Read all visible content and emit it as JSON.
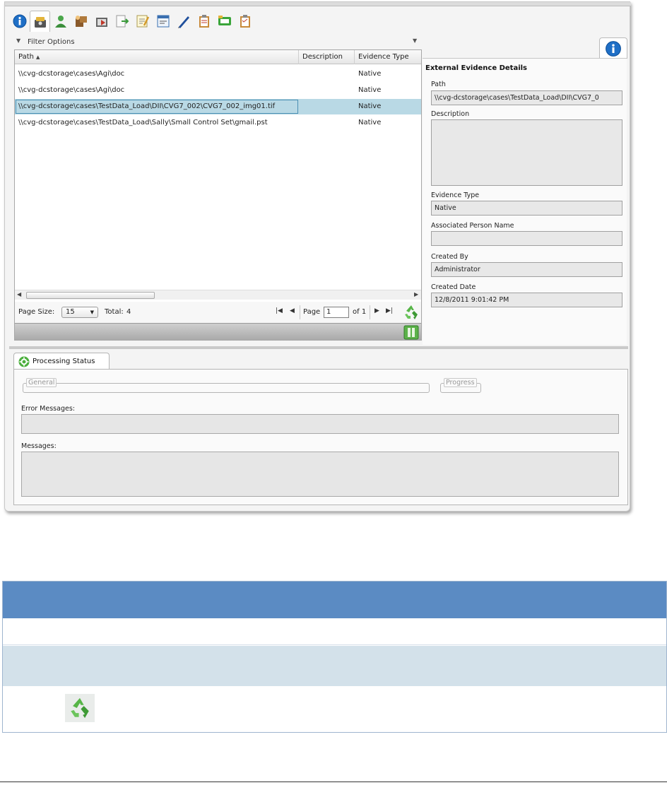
{
  "toolbar": {
    "icons": [
      "info-icon",
      "evidence-drive-icon",
      "person-icon",
      "custodian-boxes-icon",
      "media-icon",
      "export-icon",
      "notes-icon",
      "form-icon",
      "pen-icon",
      "clipboard-icon",
      "transfer-icon",
      "checklist-icon"
    ],
    "active_index": 1
  },
  "filter": {
    "label": "Filter Options"
  },
  "grid": {
    "columns": [
      "Path",
      "Description",
      "Evidence Type"
    ],
    "rows": [
      {
        "path": "\\\\cvg-dcstorage\\cases\\Agi\\doc",
        "description": "",
        "evidence_type": "Native"
      },
      {
        "path": "\\\\cvg-dcstorage\\cases\\Agi\\doc",
        "description": "",
        "evidence_type": "Native"
      },
      {
        "path": "\\\\cvg-dcstorage\\cases\\TestData_Load\\DII\\CVG7_002\\CVG7_002_img01.tif",
        "description": "",
        "evidence_type": "Native",
        "selected": true
      },
      {
        "path": "\\\\cvg-dcstorage\\cases\\TestData_Load\\Sally\\Small Control Set\\gmail.pst",
        "description": "",
        "evidence_type": "Native"
      }
    ]
  },
  "pager": {
    "page_size_label": "Page Size:",
    "page_size_value": "15",
    "total_label": "Total:",
    "total_value": "4",
    "page_label": "Page",
    "page_value": "1",
    "of_label": "of 1"
  },
  "details": {
    "title": "External Evidence Details",
    "path_label": "Path",
    "path_value": "\\\\cvg-dcstorage\\cases\\TestData_Load\\DII\\CVG7_0",
    "description_label": "Description",
    "description_value": "",
    "evidence_type_label": "Evidence Type",
    "evidence_type_value": "Native",
    "associated_person_label": "Associated Person Name",
    "associated_person_value": "",
    "created_by_label": "Created By",
    "created_by_value": "Administrator",
    "created_date_label": "Created Date",
    "created_date_value": "12/8/2011 9:01:42 PM"
  },
  "processing": {
    "tab_label": "Processing Status",
    "general_legend": "General",
    "progress_legend": "Progress",
    "error_label": "Error Messages:",
    "messages_label": "Messages:"
  },
  "colors": {
    "selected_row": "#b9d9e5",
    "table_header": "#5b8bc3",
    "table_alt_row": "#d3e1ea",
    "recycle_green": "#4caf3d"
  }
}
